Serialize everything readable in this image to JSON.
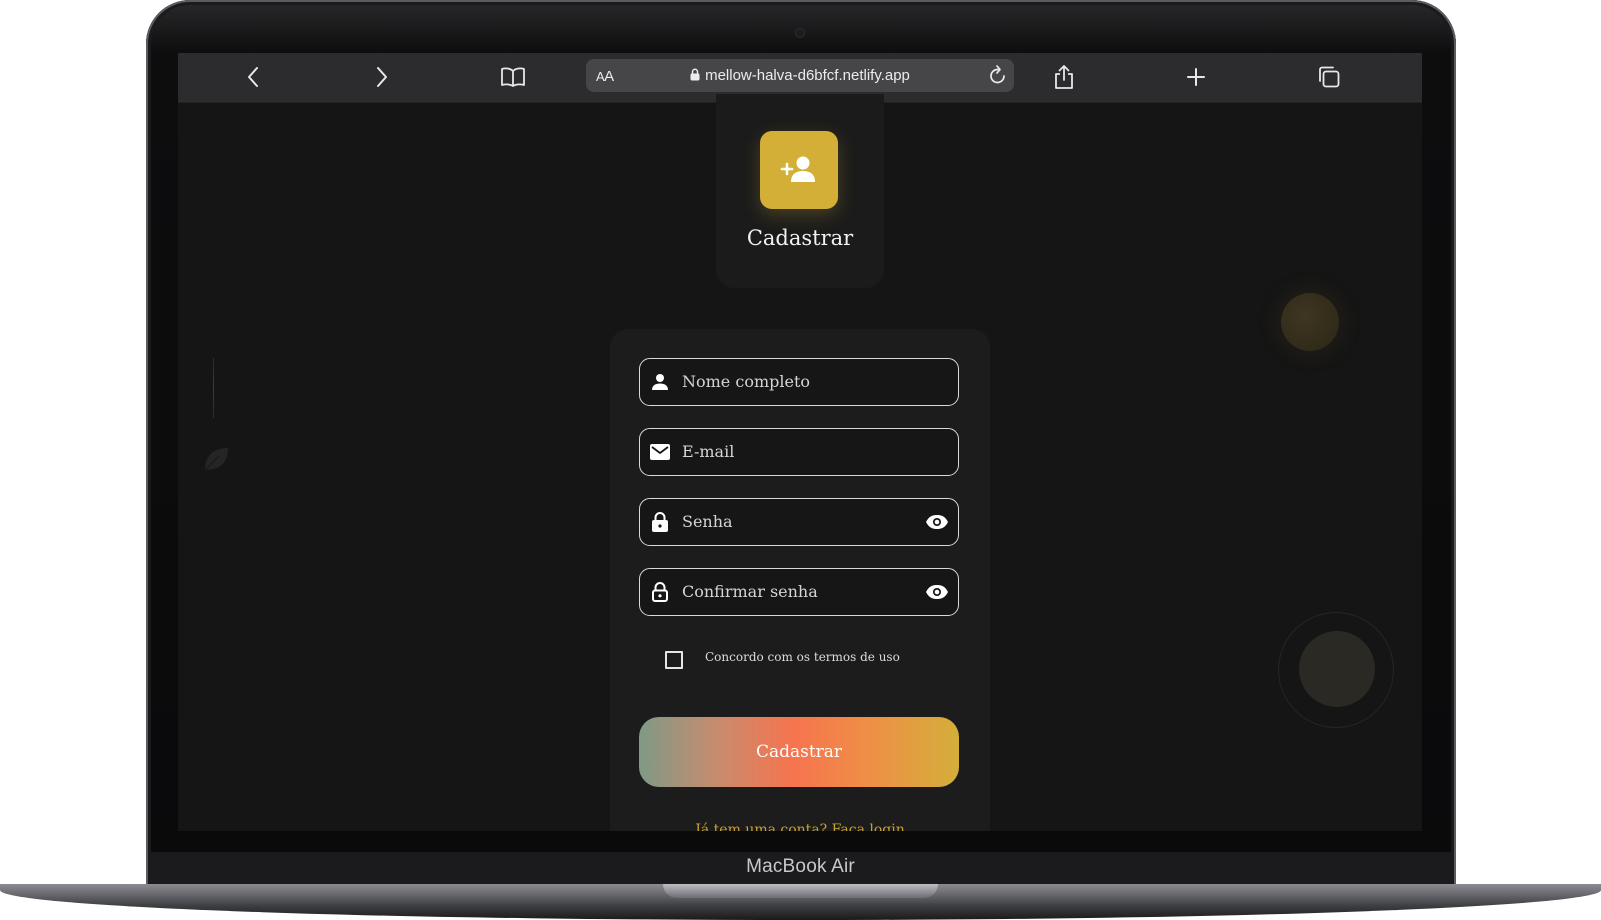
{
  "device": {
    "label": "MacBook Air"
  },
  "browser": {
    "text_size_label_small": "A",
    "text_size_label_big": "A",
    "url": "mellow-halva-d6bfcf.netlify.app",
    "icons": [
      "back-icon",
      "forward-icon",
      "bookmarks-icon",
      "lock-icon",
      "reload-icon",
      "share-icon",
      "new-tab-icon",
      "tabs-icon"
    ]
  },
  "header": {
    "icon": "person-add-icon",
    "title": "Cadastrar"
  },
  "form": {
    "name_placeholder": "Nome completo",
    "email_placeholder": "E-mail",
    "password_placeholder": "Senha",
    "confirm_placeholder": "Confirmar senha",
    "terms_label": "Concordo com os termos de uso",
    "terms_checked": false,
    "submit_label": "Cadastrar",
    "login_link": "Já tem uma conta? Faça login"
  },
  "colors": {
    "accent": "#d4af37",
    "link": "#c9a235",
    "background": "#151515",
    "card": "#1c1c1c",
    "button_gradient": [
      "#7f9a86",
      "#f6744f",
      "#d4ae3a"
    ]
  }
}
